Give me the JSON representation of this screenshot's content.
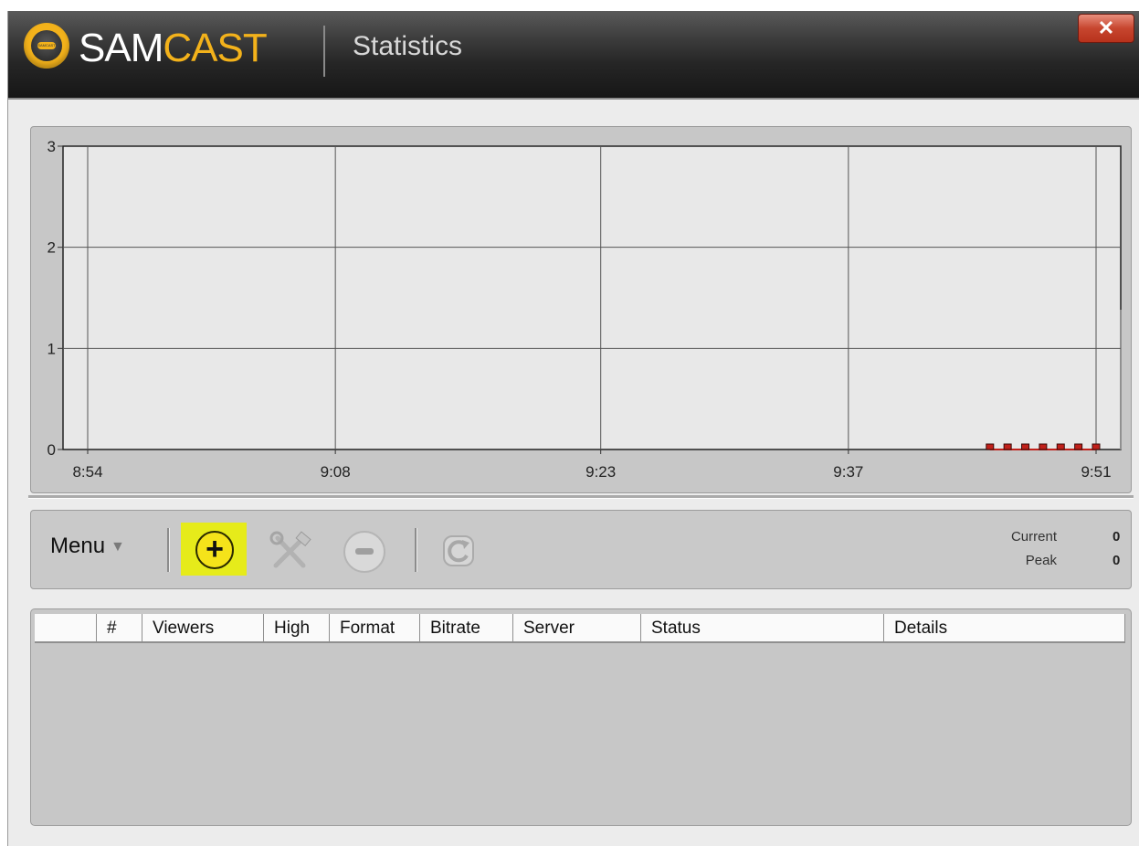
{
  "window": {
    "brand_part1": "SAM",
    "brand_part2": "CAST",
    "logo_text": "SAMCAST",
    "title": "Statistics",
    "close_glyph": "✕"
  },
  "chart_data": {
    "type": "line",
    "x_ticks": [
      "8:54",
      "9:08",
      "9:23",
      "9:37",
      "9:51"
    ],
    "y_ticks": [
      "0",
      "1",
      "2",
      "3"
    ],
    "ylim": [
      0,
      3
    ],
    "grid": true,
    "series": [
      {
        "color": "#c0201a",
        "x": [
          "9:45",
          "9:46",
          "9:47",
          "9:48",
          "9:49",
          "9:50",
          "9:51"
        ],
        "values": [
          0,
          0,
          0,
          0,
          0,
          0,
          0
        ]
      }
    ]
  },
  "toolbar": {
    "menu_label": "Menu",
    "menu_caret": "▼",
    "add_glyph": "+",
    "current_label": "Current",
    "current_value": "0",
    "peak_label": "Peak",
    "peak_value": "0"
  },
  "table": {
    "columns": [
      "",
      "#",
      "Viewers",
      "High",
      "Format",
      "Bitrate",
      "Server",
      "Status",
      "Details"
    ],
    "rows": []
  },
  "colors": {
    "accent": "#f3b21b",
    "highlight": "#e6eb1a",
    "series": "#c0201a"
  }
}
